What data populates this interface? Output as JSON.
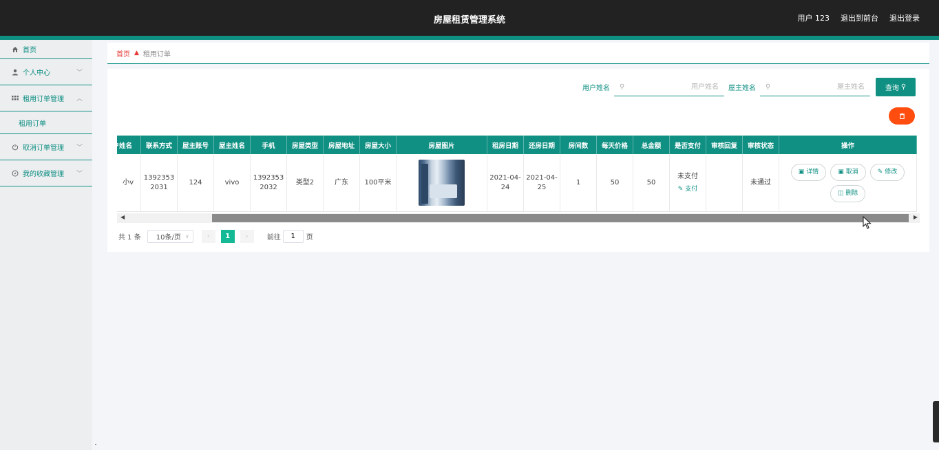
{
  "header": {
    "title": "房屋租赁管理系统",
    "user_label": "用户 123",
    "to_front": "退出到前台",
    "logout": "退出登录"
  },
  "sidebar": {
    "items": [
      {
        "label": "首页",
        "icon": "home-icon"
      },
      {
        "label": "个人中心",
        "icon": "user-icon"
      },
      {
        "label": "租用订单管理",
        "icon": "grid-icon",
        "expanded": true,
        "sub": [
          "租用订单"
        ]
      },
      {
        "label": "取消订单管理",
        "icon": "power-icon"
      },
      {
        "label": "我的收藏管理",
        "icon": "compass-icon"
      }
    ]
  },
  "breadcrumb": {
    "home": "首页",
    "current": "租用订单"
  },
  "search": {
    "user_label": "用户姓名",
    "user_placeholder": "用户姓名",
    "owner_label": "屋主姓名",
    "owner_placeholder": "屋主姓名",
    "query_button": "查询"
  },
  "table": {
    "headers": [
      "用户姓名",
      "联系方式",
      "屋主账号",
      "屋主姓名",
      "手机",
      "房屋类型",
      "房屋地址",
      "房屋大小",
      "房屋图片",
      "租房日期",
      "还房日期",
      "房间数",
      "每天价格",
      "总金额",
      "是否支付",
      "审核回复",
      "审核状态",
      "操作"
    ],
    "rows": [
      {
        "user_name": "小v",
        "contact": "13923532031",
        "owner_account": "124",
        "owner_name": "vivo",
        "phone": "13923532032",
        "house_type": "类型2",
        "address": "广东",
        "size": "100平米",
        "rent_date": "2021-04-24",
        "return_date": "2021-04-25",
        "rooms": "1",
        "daily_price": "50",
        "total": "50",
        "paid": "未支付",
        "pay_link": "支付",
        "reply": "",
        "status": "未通过"
      }
    ],
    "ops": {
      "detail": "详情",
      "cancel": "取消",
      "edit": "修改",
      "delete": "删除"
    }
  },
  "pager": {
    "total": "共 1 条",
    "page_size": "10条/页",
    "current_page": "1",
    "goto_label": "前往",
    "goto_value": "1",
    "page_unit": "页"
  },
  "colors": {
    "primary": "#109083",
    "danger": "#ff4d0f",
    "page_active": "#13ba95",
    "header_bg": "#222222"
  }
}
